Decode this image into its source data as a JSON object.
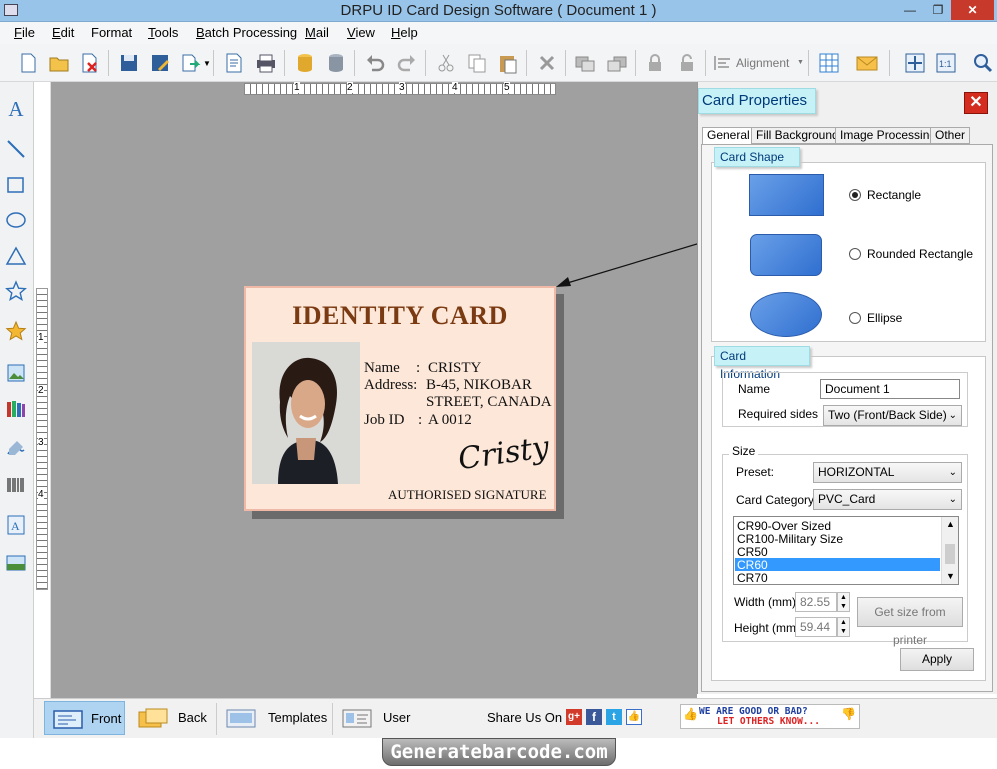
{
  "window": {
    "title": "DRPU ID Card Design Software ( Document 1 )"
  },
  "menu": [
    {
      "label": "File",
      "key": "F",
      "rest": "ile"
    },
    {
      "label": "Edit",
      "key": "E",
      "rest": "dit"
    },
    {
      "label": "Format",
      "key": "",
      "rest": "Format"
    },
    {
      "label": "Tools",
      "key": "T",
      "rest": "ools"
    },
    {
      "label": "Batch Processing",
      "key": "B",
      "rest": "atch Processing"
    },
    {
      "label": "Mail",
      "key": "M",
      "rest": "ail"
    },
    {
      "label": "View",
      "key": "V",
      "rest": "iew"
    },
    {
      "label": "Help",
      "key": "H",
      "rest": "elp"
    }
  ],
  "toolbar": {
    "alignment_label": "Alignment"
  },
  "ruler": {
    "h_ticks": [
      "1",
      "2",
      "3",
      "4",
      "5"
    ],
    "v_ticks": [
      "1",
      "2",
      "3",
      "4"
    ]
  },
  "card": {
    "heading": "IDENTITY CARD",
    "name_label": "Name",
    "name_sep": ":",
    "name_value": "CRISTY",
    "address_label": "Address:",
    "address_line1": "B-45, NIKOBAR",
    "address_line2": "STREET, CANADA",
    "jobid_label": "Job ID",
    "jobid_sep": ":",
    "jobid_value": "A 0012",
    "signature": "Cristy",
    "signature_caption": "AUTHORISED SIGNATURE"
  },
  "props": {
    "title": "Card Properties",
    "tabs": [
      "General",
      "Fill Background",
      "Image Processing",
      "Other"
    ],
    "active_tab": "General",
    "card_shape_title": "Card Shape",
    "shapes": [
      {
        "label": "Rectangle",
        "selected": true
      },
      {
        "label": "Rounded Rectangle",
        "selected": false
      },
      {
        "label": "Ellipse",
        "selected": false
      }
    ],
    "card_info_title": "Card Information",
    "name_label": "Name",
    "name_value": "Document 1",
    "sides_label": "Required sides",
    "sides_value": "Two (Front/Back Side)",
    "size_label": "Size",
    "preset_label": "Preset:",
    "preset_value": "HORIZONTAL",
    "category_label": "Card Category",
    "category_value": "PVC_Card",
    "size_list": [
      "CR90-Over Sized",
      "CR100-Military Size",
      "CR50",
      "CR60",
      "CR70"
    ],
    "size_selected": "CR60",
    "width_label": "Width  (mm)",
    "width_value": "82.55",
    "height_label": "Height  (mm)",
    "height_value": "59.44",
    "printer_button": "Get size from printer",
    "apply_button": "Apply"
  },
  "bottom": {
    "front": "Front",
    "back": "Back",
    "templates": "Templates",
    "user_profile": "User Profile",
    "share_label": "Share Us On :",
    "feedback_line1": "WE ARE GOOD OR BAD?",
    "feedback_line2": "LET OTHERS KNOW..."
  },
  "footer": {
    "brand": "Generatebarcode.com"
  },
  "colors": {
    "titlebar": "#99c4e9",
    "canvas": "#a0a0a0",
    "card_bg": "#fde7d8",
    "heading": "#7a3a12",
    "accent": "#3399ff"
  }
}
